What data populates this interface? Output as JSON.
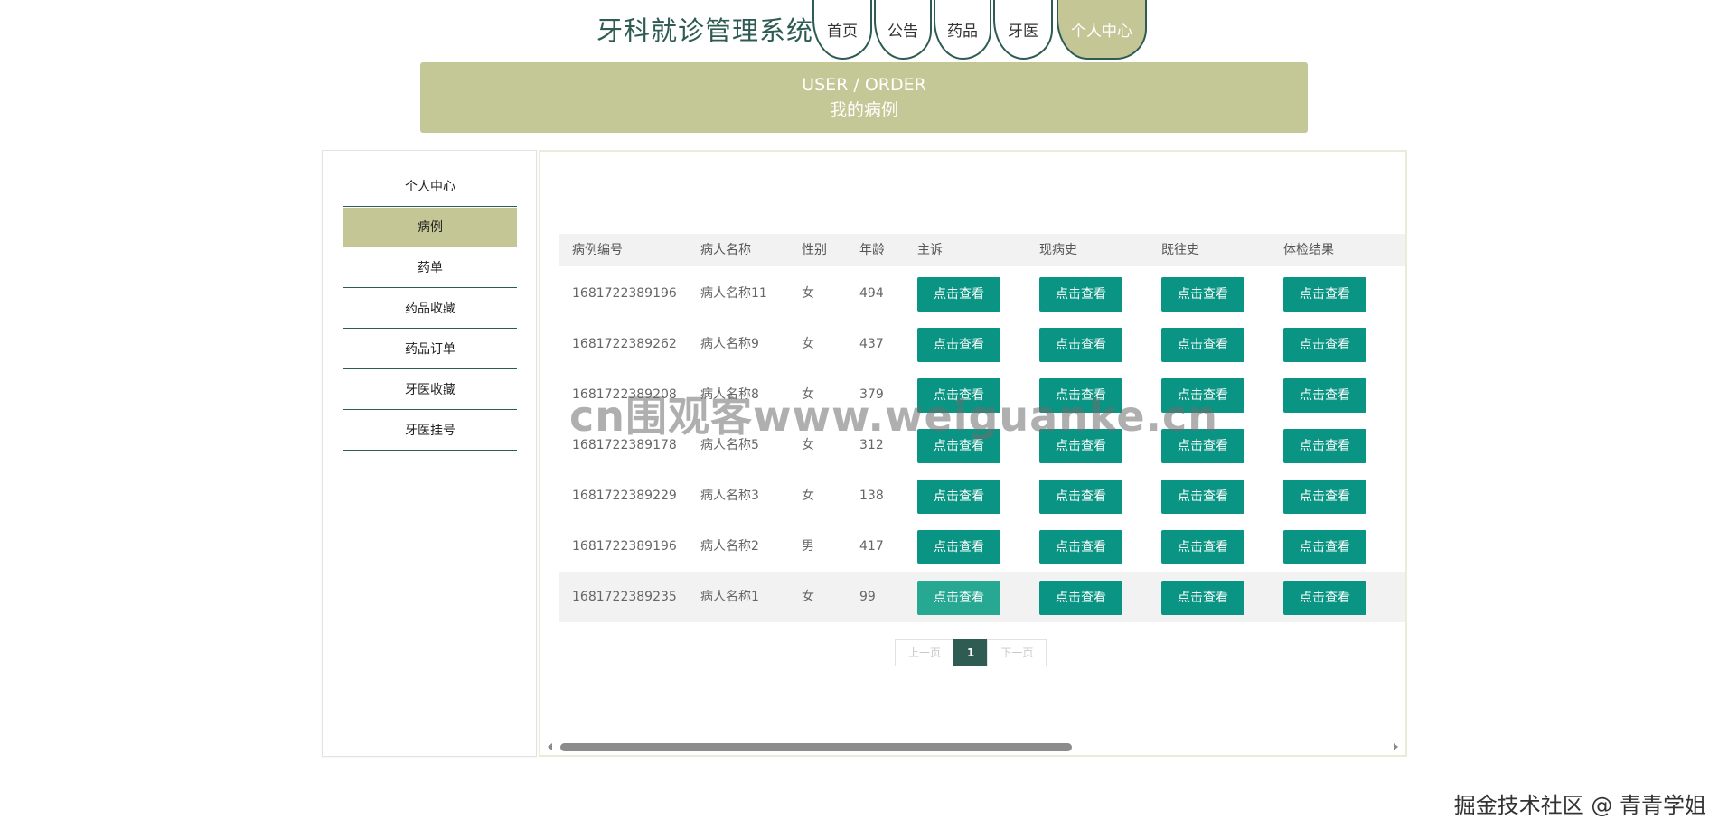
{
  "site_title": "牙科就诊管理系统",
  "nav": [
    {
      "label": "首页",
      "active": false
    },
    {
      "label": "公告",
      "active": false
    },
    {
      "label": "药品",
      "active": false
    },
    {
      "label": "牙医",
      "active": false
    },
    {
      "label": "个人中心",
      "active": true
    }
  ],
  "banner": {
    "en": "USER / ORDER",
    "cn": "我的病例"
  },
  "sidebar": {
    "items": [
      {
        "label": "个人中心",
        "active": false
      },
      {
        "label": "病例",
        "active": true
      },
      {
        "label": "药单",
        "active": false
      },
      {
        "label": "药品收藏",
        "active": false
      },
      {
        "label": "药品订单",
        "active": false
      },
      {
        "label": "牙医收藏",
        "active": false
      },
      {
        "label": "牙医挂号",
        "active": false
      }
    ]
  },
  "table": {
    "headers": [
      "病例编号",
      "病人名称",
      "性别",
      "年龄",
      "主诉",
      "现病史",
      "既往史",
      "体检结果"
    ],
    "view_label": "点击查看",
    "rows": [
      {
        "id": "1681722389196",
        "name": "病人名称11",
        "gender": "女",
        "age": "494"
      },
      {
        "id": "1681722389262",
        "name": "病人名称9",
        "gender": "女",
        "age": "437"
      },
      {
        "id": "1681722389208",
        "name": "病人名称8",
        "gender": "女",
        "age": "379"
      },
      {
        "id": "1681722389178",
        "name": "病人名称5",
        "gender": "女",
        "age": "312"
      },
      {
        "id": "1681722389229",
        "name": "病人名称3",
        "gender": "女",
        "age": "138"
      },
      {
        "id": "1681722389196",
        "name": "病人名称2",
        "gender": "男",
        "age": "417"
      },
      {
        "id": "1681722389235",
        "name": "病人名称1",
        "gender": "女",
        "age": "99"
      }
    ]
  },
  "pagination": {
    "prev": "上一页",
    "current": "1",
    "next": "下一页"
  },
  "watermark": "cn围观客www.weiguanke.cn",
  "credit": "掘金技术社区 @ 青青学姐",
  "colors": {
    "primary": "#2e5b52",
    "accent": "#c4c696",
    "button": "#0a9483"
  }
}
